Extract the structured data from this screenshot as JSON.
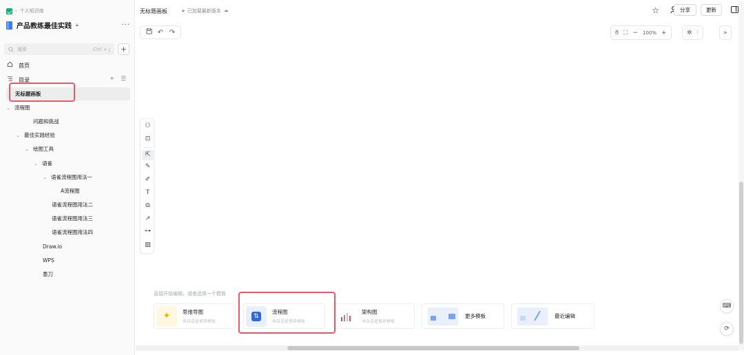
{
  "breadcrumb": {
    "separator": "›",
    "label": "个人知识库"
  },
  "knowledge_base": {
    "name": "产品教练最佳实践",
    "lock": "🔒︎",
    "more": "···"
  },
  "search": {
    "placeholder": "搜索",
    "shortcut": "Ctrl + J",
    "add": "+"
  },
  "nav": {
    "home": "首页",
    "toc": "目录"
  },
  "tree": [
    {
      "label": "无标题画板",
      "active": true
    },
    {
      "caret": "⌄",
      "label": "流程图"
    },
    {
      "label": "问题和挑战"
    },
    {
      "caret": "⌄",
      "label": "最佳实践经验"
    },
    {
      "caret": "⌄",
      "label": "绘图工具"
    },
    {
      "caret": "⌄",
      "label": "语雀"
    },
    {
      "caret": "⌄",
      "label": "语雀流程图用法一"
    },
    {
      "label": "A流程图"
    },
    {
      "label": "语雀流程图用法二"
    },
    {
      "label": "语雀流程图用法三"
    },
    {
      "label": "语雀流程图用法四"
    },
    {
      "label": "Draw.io"
    },
    {
      "label": "WPS"
    },
    {
      "label": "墨刀"
    }
  ],
  "header": {
    "title": "无标题画板",
    "status": "已加载最新版本",
    "share": "分享",
    "update": "更新"
  },
  "canvas": {
    "zoom": "100%",
    "zoom_out": "−",
    "zoom_in": "+"
  },
  "templates": {
    "hint": "直接开始编辑，或者选择一个模板",
    "items": [
      {
        "title": "思维导图",
        "sub": "来自语雀推荐模板"
      },
      {
        "title": "流程图",
        "sub": "来自语雀推荐模板"
      },
      {
        "title": "架构图",
        "sub": "来自语雀推荐模板"
      },
      {
        "title": "更多模板"
      },
      {
        "title": "最近编辑"
      }
    ]
  },
  "colors": {
    "accent": "#00b96b",
    "highlight": "#f0566a",
    "blue": "#3f7ef7"
  }
}
